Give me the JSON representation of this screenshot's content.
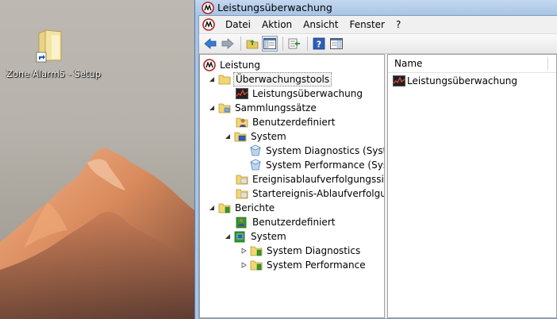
{
  "desktop": {
    "icon_label": "Zone Alarm5 - Setup",
    "icon_name": "folder-shortcut-icon"
  },
  "window": {
    "title": "Leistungsüberwachung",
    "menu": [
      "Datei",
      "Aktion",
      "Ansicht",
      "Fenster",
      "?"
    ],
    "toolbar": [
      "back-icon",
      "forward-icon",
      "up-folder-icon",
      "show-hide-tree-icon",
      "export-list-icon",
      "help-icon",
      "properties-icon"
    ]
  },
  "tree": {
    "root": "Leistung",
    "items": [
      {
        "label": "Überwachungstools",
        "icon": "folder-icon"
      },
      {
        "label": "Leistungsüberwachung",
        "icon": "performance-monitor-icon"
      },
      {
        "label": "Sammlungssätze",
        "icon": "folder-icon"
      },
      {
        "label": "Benutzerdefiniert",
        "icon": "user-collector-icon"
      },
      {
        "label": "System",
        "icon": "system-collector-icon"
      },
      {
        "label": "System Diagnostics (System",
        "icon": "data-collector-icon"
      },
      {
        "label": "System Performance (Syster",
        "icon": "data-collector-icon"
      },
      {
        "label": "Ereignisablaufverfolgungssitzur",
        "icon": "trace-folder-icon"
      },
      {
        "label": "Startereignis-Ablaufverfolgungs",
        "icon": "trace-folder-icon"
      },
      {
        "label": "Berichte",
        "icon": "reports-folder-icon"
      },
      {
        "label": "Benutzerdefiniert",
        "icon": "user-report-icon"
      },
      {
        "label": "System",
        "icon": "system-report-icon"
      },
      {
        "label": "System Diagnostics",
        "icon": "report-folder-icon"
      },
      {
        "label": "System Performance",
        "icon": "report-folder-icon"
      }
    ]
  },
  "list": {
    "column_name": "Name",
    "rows": [
      {
        "label": "Leistungsüberwachung",
        "icon": "performance-monitor-icon"
      }
    ]
  },
  "colors": {
    "window_frame": "#a9c4e4",
    "selection_border": "#808080"
  }
}
